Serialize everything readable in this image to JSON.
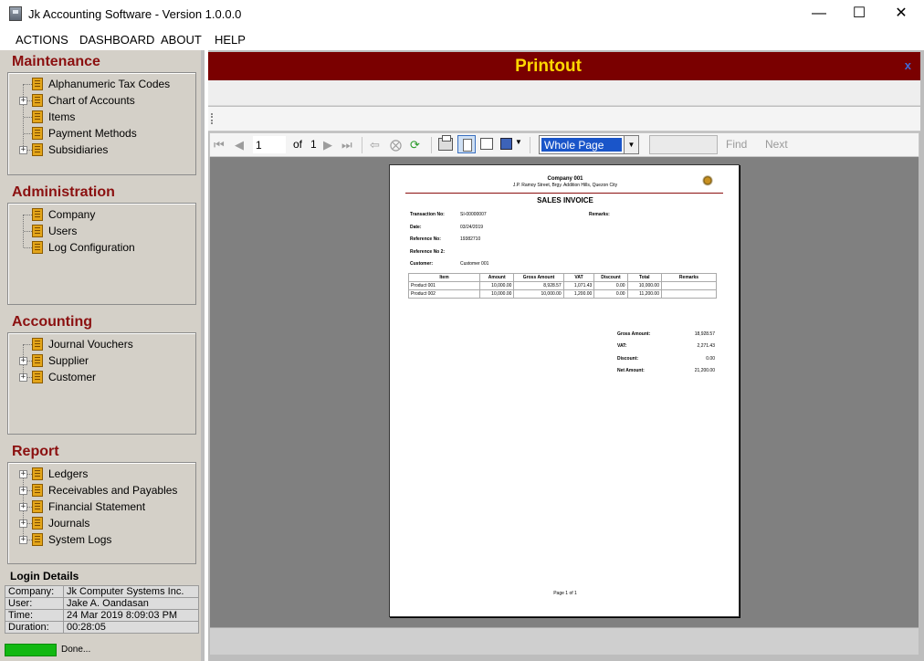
{
  "window": {
    "title": "Jk Accounting Software - Version 1.0.0.0"
  },
  "menu": [
    "ACTIONS",
    "DASHBOARD",
    "ABOUT",
    "HELP"
  ],
  "sidebar": {
    "maintenance": {
      "title": "Maintenance",
      "items": [
        {
          "label": "Alphanumeric Tax Codes",
          "expandable": false
        },
        {
          "label": "Chart of Accounts",
          "expandable": true
        },
        {
          "label": "Items",
          "expandable": false
        },
        {
          "label": "Payment Methods",
          "expandable": false
        },
        {
          "label": "Subsidiaries",
          "expandable": true
        }
      ]
    },
    "administration": {
      "title": "Administration",
      "items": [
        {
          "label": "Company",
          "expandable": false
        },
        {
          "label": "Users",
          "expandable": false
        },
        {
          "label": "Log Configuration",
          "expandable": false
        }
      ]
    },
    "accounting": {
      "title": "Accounting",
      "items": [
        {
          "label": "Journal Vouchers",
          "expandable": false
        },
        {
          "label": "Supplier",
          "expandable": true
        },
        {
          "label": "Customer",
          "expandable": true
        }
      ]
    },
    "report": {
      "title": "Report",
      "items": [
        {
          "label": "Ledgers",
          "expandable": true
        },
        {
          "label": "Receivables and Payables",
          "expandable": true
        },
        {
          "label": "Financial Statement",
          "expandable": true
        },
        {
          "label": "Journals",
          "expandable": true
        },
        {
          "label": "System Logs",
          "expandable": true
        }
      ]
    }
  },
  "login": {
    "title": "Login Details",
    "rows": [
      {
        "label": "Company:",
        "value": "Jk Computer Systems Inc."
      },
      {
        "label": "User:",
        "value": "Jake A. Oandasan"
      },
      {
        "label": "Time:",
        "value": "24 Mar 2019 8:09:03 PM"
      },
      {
        "label": "Duration:",
        "value": "00:28:05"
      }
    ]
  },
  "status": {
    "text": "Done...",
    "progress": 1.0,
    "color": "#12b812"
  },
  "printout": {
    "title": "Printout",
    "close": "x",
    "toolbar": {
      "page": "1",
      "of": "of",
      "total_pages": "1",
      "zoom": "Whole Page",
      "find": "Find",
      "next": "Next"
    }
  },
  "invoice": {
    "company": "Company 001",
    "address": "J.P. Ramoy Street, Brgy. Addition Hills, Quezon City",
    "title": "SALES INVOICE",
    "fields": [
      {
        "label": "Transaction No:",
        "value": "SI-00000007"
      },
      {
        "label": "Date:",
        "value": "03/24/2019"
      },
      {
        "label": "Reference No:",
        "value": "19382710"
      },
      {
        "label": "Reference No 2:",
        "value": ""
      },
      {
        "label": "Customer:",
        "value": "Customer 001"
      }
    ],
    "remarks_label": "Remarks:",
    "columns": [
      "Item",
      "Amount",
      "Gross Amount",
      "VAT",
      "Discount",
      "Total",
      "Remarks"
    ],
    "rows": [
      [
        "Product 001",
        "10,000.00",
        "8,928.57",
        "1,071.43",
        "0.00",
        "10,000.00",
        ""
      ],
      [
        "Product 002",
        "10,000.00",
        "10,000.00",
        "1,200.00",
        "0.00",
        "11,200.00",
        ""
      ]
    ],
    "totals": [
      {
        "label": "Gross Amount:",
        "value": "18,928.57"
      },
      {
        "label": "VAT:",
        "value": "2,271.43"
      },
      {
        "label": "Discount:",
        "value": "0.00"
      },
      {
        "label": "Net Amount:",
        "value": "21,200.00"
      }
    ],
    "footer": "Page 1 of 1"
  },
  "colors": {
    "accent": "#7a0000",
    "section_title": "#8b1010",
    "title_text": "#ffd800",
    "zoom_highlight": "#1a55c9"
  }
}
